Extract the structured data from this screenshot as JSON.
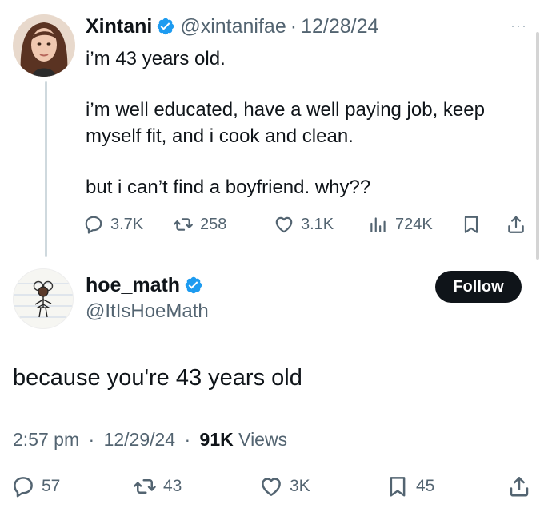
{
  "original_tweet": {
    "author": {
      "name": "Xintani",
      "handle": "@xintanifae",
      "verified": true
    },
    "date": "12/28/24",
    "separator": "·",
    "more_label": "···",
    "body": {
      "line1": "i’m 43 years old.",
      "line2": "i’m well educated, have a well paying job, keep myself fit, and i cook and clean.",
      "line3": "but i can’t find a boyfriend. why??"
    },
    "stats": {
      "replies": "3.7K",
      "reposts": "258",
      "likes": "3.1K",
      "views": "724K"
    }
  },
  "reply_tweet": {
    "author": {
      "name": "hoe_math",
      "handle": "@ItIsHoeMath",
      "verified": true
    },
    "follow_label": "Follow",
    "text": "because you're 43 years old",
    "time": "2:57 pm",
    "date": "12/29/24",
    "separator": "·",
    "views_count": "91K",
    "views_label": "Views",
    "stats": {
      "replies": "57",
      "reposts": "43",
      "likes": "3K",
      "bookmarks": "45"
    }
  },
  "colors": {
    "text": "#0f1419",
    "muted": "#536471",
    "verified_blue": "#1d9bf0",
    "follow_bg": "#0f1419"
  },
  "icons": [
    "verified-icon",
    "more-icon",
    "reply-icon",
    "repost-icon",
    "like-icon",
    "views-icon",
    "bookmark-icon",
    "share-icon"
  ]
}
